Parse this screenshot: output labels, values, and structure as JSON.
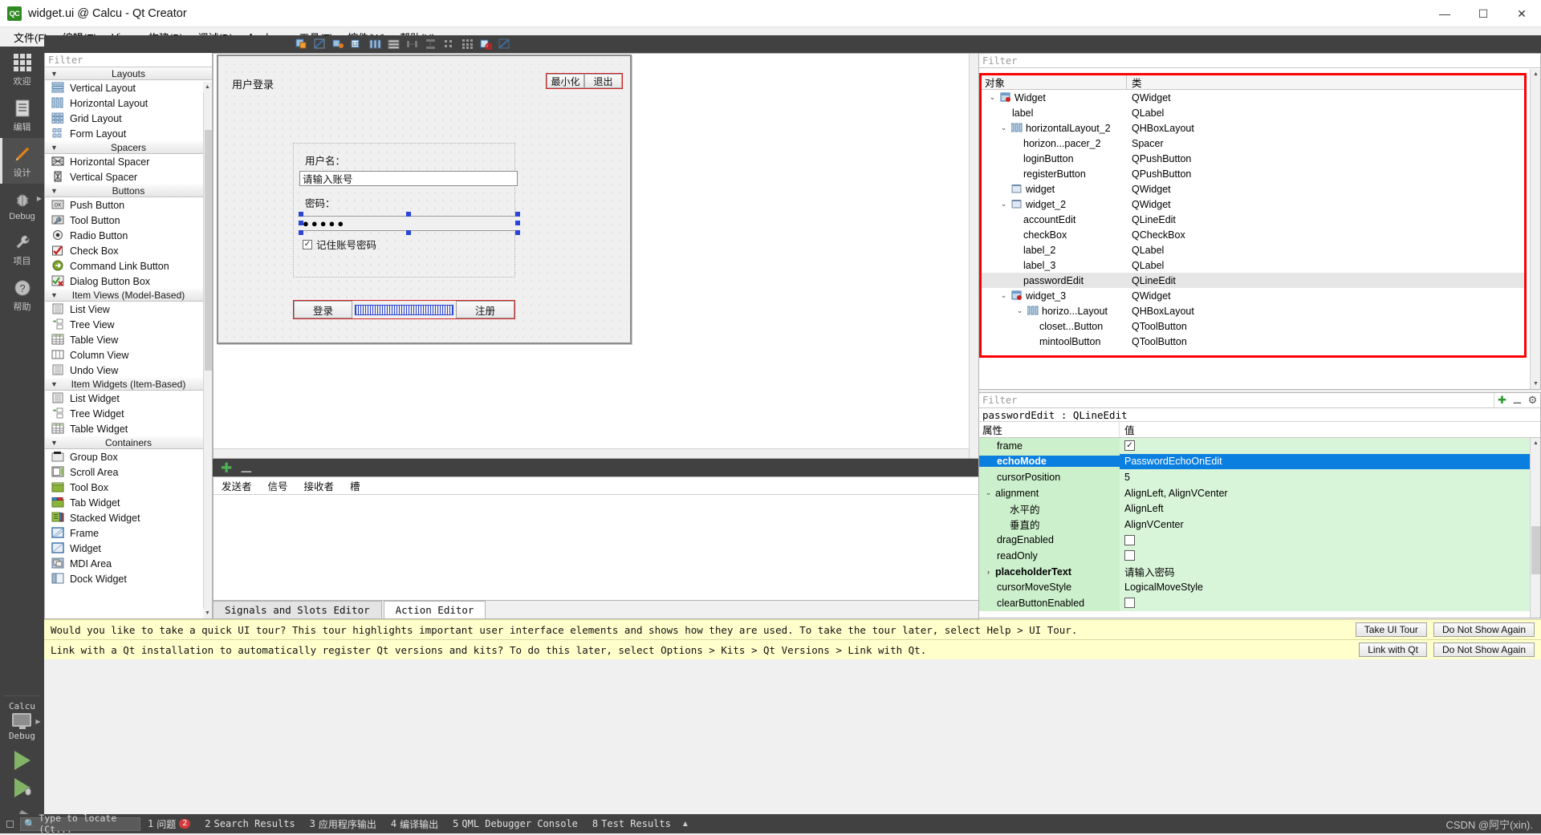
{
  "window": {
    "title": "widget.ui @ Calcu - Qt Creator",
    "logo": "QC",
    "minimize": "—",
    "maximize": "☐",
    "close": "✕"
  },
  "menubar": [
    {
      "label": "文件(F)"
    },
    {
      "label": "编辑(E)"
    },
    {
      "label": "View"
    },
    {
      "label": "构建(B)"
    },
    {
      "label": "调试(D)"
    },
    {
      "label": "Analyze"
    },
    {
      "label": "工具(T)"
    },
    {
      "label": "控件(W)"
    },
    {
      "label": "帮助(H)"
    }
  ],
  "modebar": {
    "items": [
      {
        "label": "欢迎",
        "icon": "grid-icon"
      },
      {
        "label": "编辑",
        "icon": "document-icon"
      },
      {
        "label": "设计",
        "icon": "pencil-icon",
        "active": true
      },
      {
        "label": "Debug",
        "icon": "bug-icon"
      },
      {
        "label": "项目",
        "icon": "wrench-icon"
      },
      {
        "label": "帮助",
        "icon": "question-icon"
      }
    ],
    "kit_name": "Calcu",
    "build_config": "Debug"
  },
  "filetab": {
    "name": "widget.ui"
  },
  "widgetbox": {
    "filter_placeholder": "Filter",
    "groups": [
      {
        "title": "Layouts",
        "items": [
          {
            "label": "Vertical Layout",
            "icon": "vertical-layout-icon"
          },
          {
            "label": "Horizontal Layout",
            "icon": "horizontal-layout-icon"
          },
          {
            "label": "Grid Layout",
            "icon": "grid-layout-icon"
          },
          {
            "label": "Form Layout",
            "icon": "form-layout-icon"
          }
        ]
      },
      {
        "title": "Spacers",
        "items": [
          {
            "label": "Horizontal Spacer",
            "icon": "horizontal-spacer-icon"
          },
          {
            "label": "Vertical Spacer",
            "icon": "vertical-spacer-icon"
          }
        ]
      },
      {
        "title": "Buttons",
        "items": [
          {
            "label": "Push Button",
            "icon": "push-button-icon"
          },
          {
            "label": "Tool Button",
            "icon": "tool-button-icon"
          },
          {
            "label": "Radio Button",
            "icon": "radio-button-icon"
          },
          {
            "label": "Check Box",
            "icon": "check-box-icon"
          },
          {
            "label": "Command Link Button",
            "icon": "command-link-icon"
          },
          {
            "label": "Dialog Button Box",
            "icon": "dialog-button-box-icon"
          }
        ]
      },
      {
        "title": "Item Views (Model-Based)",
        "items": [
          {
            "label": "List View",
            "icon": "list-view-icon"
          },
          {
            "label": "Tree View",
            "icon": "tree-view-icon"
          },
          {
            "label": "Table View",
            "icon": "table-view-icon"
          },
          {
            "label": "Column View",
            "icon": "column-view-icon"
          },
          {
            "label": "Undo View",
            "icon": "undo-view-icon"
          }
        ]
      },
      {
        "title": "Item Widgets (Item-Based)",
        "items": [
          {
            "label": "List Widget",
            "icon": "list-widget-icon"
          },
          {
            "label": "Tree Widget",
            "icon": "tree-widget-icon"
          },
          {
            "label": "Table Widget",
            "icon": "table-widget-icon"
          }
        ]
      },
      {
        "title": "Containers",
        "items": [
          {
            "label": "Group Box",
            "icon": "group-box-icon"
          },
          {
            "label": "Scroll Area",
            "icon": "scroll-area-icon"
          },
          {
            "label": "Tool Box",
            "icon": "tool-box-icon"
          },
          {
            "label": "Tab Widget",
            "icon": "tab-widget-icon"
          },
          {
            "label": "Stacked Widget",
            "icon": "stacked-widget-icon"
          },
          {
            "label": "Frame",
            "icon": "frame-icon"
          },
          {
            "label": "Widget",
            "icon": "widget-icon"
          },
          {
            "label": "MDI Area",
            "icon": "mdi-area-icon"
          },
          {
            "label": "Dock Widget",
            "icon": "dock-widget-icon"
          }
        ]
      }
    ]
  },
  "form": {
    "title": "用户登录",
    "minimize_button": "最小化",
    "exit_button": "退出",
    "username_label": "用户名：",
    "username_placeholder": "请输入账号",
    "password_label": "密码：",
    "password_masked": "●●●●●",
    "remember_label": "记住账号密码",
    "remember_checked": "✓",
    "login_button": "登录",
    "register_button": "注册"
  },
  "signals_panel": {
    "columns": [
      "发送者",
      "信号",
      "接收者",
      "槽"
    ],
    "tabs": [
      {
        "label": "Signals and Slots Editor",
        "active": false
      },
      {
        "label": "Action Editor",
        "active": true
      }
    ]
  },
  "object_inspector": {
    "filter_placeholder": "Filter",
    "columns": [
      "对象",
      "类"
    ],
    "rows": [
      {
        "indent": 0,
        "chev": "⌄",
        "icon": "widget-icon",
        "name": "Widget",
        "class": "QWidget"
      },
      {
        "indent": 1,
        "chev": "",
        "icon": "label-icon",
        "name": "label",
        "class": "QLabel"
      },
      {
        "indent": 1,
        "chev": "⌄",
        "icon": "hlayout-icon",
        "name": "horizontalLayout_2",
        "class": "QHBoxLayout"
      },
      {
        "indent": 2,
        "chev": "",
        "icon": "spacer-icon",
        "name": "horizon...pacer_2",
        "class": "Spacer"
      },
      {
        "indent": 2,
        "chev": "",
        "icon": "button-icon",
        "name": "loginButton",
        "class": "QPushButton"
      },
      {
        "indent": 2,
        "chev": "",
        "icon": "button-icon",
        "name": "registerButton",
        "class": "QPushButton"
      },
      {
        "indent": 1,
        "chev": "",
        "icon": "widget-icon",
        "name": "widget",
        "class": "QWidget"
      },
      {
        "indent": 1,
        "chev": "⌄",
        "icon": "widget-icon",
        "name": "widget_2",
        "class": "QWidget"
      },
      {
        "indent": 2,
        "chev": "",
        "icon": "lineedit-icon",
        "name": "accountEdit",
        "class": "QLineEdit"
      },
      {
        "indent": 2,
        "chev": "",
        "icon": "checkbox-icon",
        "name": "checkBox",
        "class": "QCheckBox"
      },
      {
        "indent": 2,
        "chev": "",
        "icon": "label-icon",
        "name": "label_2",
        "class": "QLabel"
      },
      {
        "indent": 2,
        "chev": "",
        "icon": "label-icon",
        "name": "label_3",
        "class": "QLabel"
      },
      {
        "indent": 2,
        "chev": "",
        "icon": "lineedit-icon",
        "name": "passwordEdit",
        "class": "QLineEdit",
        "selected": true
      },
      {
        "indent": 1,
        "chev": "⌄",
        "icon": "widget-icon",
        "name": "widget_3",
        "class": "QWidget"
      },
      {
        "indent": 2,
        "chev": "⌄",
        "icon": "hlayout-icon",
        "name": "horizo...Layout",
        "class": "QHBoxLayout"
      },
      {
        "indent": 3,
        "chev": "",
        "icon": "toolbutton-icon",
        "name": "closet...Button",
        "class": "QToolButton"
      },
      {
        "indent": 3,
        "chev": "",
        "icon": "toolbutton-icon",
        "name": "mintoolButton",
        "class": "QToolButton"
      }
    ]
  },
  "property_editor": {
    "filter_placeholder": "Filter",
    "object_line": "passwordEdit : QLineEdit",
    "columns": [
      "属性",
      "值"
    ],
    "rows": [
      {
        "name": "frame",
        "value": "",
        "checkbox": true,
        "checked": true,
        "indent": 1
      },
      {
        "name": "echoMode",
        "value": "PasswordEchoOnEdit",
        "selected": true,
        "bold": true,
        "indent": 1
      },
      {
        "name": "cursorPosition",
        "value": "5",
        "indent": 1
      },
      {
        "name": "alignment",
        "value": "AlignLeft, AlignVCenter",
        "chev": "⌄",
        "indent": 0
      },
      {
        "name": "水平的",
        "value": "AlignLeft",
        "indent": 2
      },
      {
        "name": "垂直的",
        "value": "AlignVCenter",
        "indent": 2
      },
      {
        "name": "dragEnabled",
        "value": "",
        "checkbox": true,
        "checked": false,
        "indent": 1
      },
      {
        "name": "readOnly",
        "value": "",
        "checkbox": true,
        "checked": false,
        "indent": 1
      },
      {
        "name": "placeholderText",
        "value": "请输入密码",
        "chev": "›",
        "bold": true,
        "indent": 0
      },
      {
        "name": "cursorMoveStyle",
        "value": "LogicalMoveStyle",
        "indent": 1
      },
      {
        "name": "clearButtonEnabled",
        "value": "",
        "checkbox": true,
        "checked": false,
        "indent": 1
      }
    ]
  },
  "notifications": [
    {
      "message": "Would you like to take a quick UI tour? This tour highlights important user interface elements and shows how they are used. To take the tour later, select Help > UI Tour.",
      "primary": "Take UI Tour",
      "secondary": "Do Not Show Again"
    },
    {
      "message": "Link with a Qt installation to automatically register Qt versions and kits? To do this later, select Options > Kits > Qt Versions > Link with Qt.",
      "primary": "Link with Qt",
      "secondary": "Do Not Show Again"
    }
  ],
  "statusbar": {
    "locate_placeholder": "Type to locate (Ct...",
    "items": [
      {
        "num": "1",
        "label": "问题",
        "badge": "2"
      },
      {
        "num": "2",
        "label": "Search Results",
        "badge": ""
      },
      {
        "num": "3",
        "label": "应用程序输出",
        "badge": ""
      },
      {
        "num": "4",
        "label": "编译输出",
        "badge": ""
      },
      {
        "num": "5",
        "label": "QML Debugger Console",
        "badge": ""
      },
      {
        "num": "8",
        "label": "Test Results",
        "badge": ""
      }
    ],
    "watermark": "CSDN @阿宁(xin)."
  }
}
